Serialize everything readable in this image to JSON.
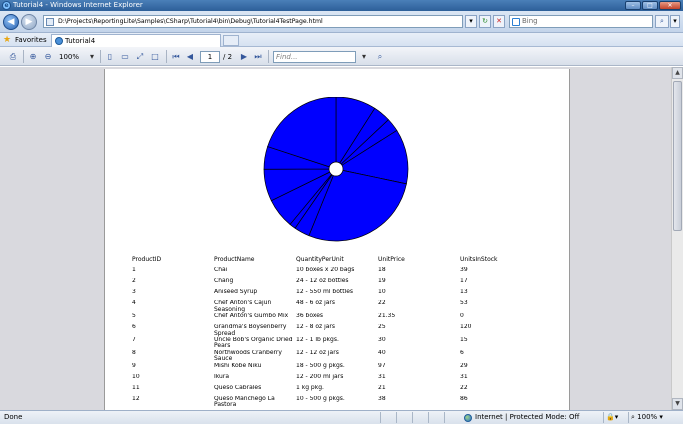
{
  "window": {
    "title": "Tutorial4 - Windows Internet Explorer",
    "controls": [
      "minimize",
      "maximize",
      "close"
    ]
  },
  "navigation": {
    "address": "D:\\Projects\\ReportingLite\\Samples\\CSharp\\Tutorial4\\bin\\Debug\\Tutorial4TestPage.html",
    "search_placeholder": "Bing"
  },
  "favorites": {
    "label": "Favorites",
    "tab_title": "Tutorial4"
  },
  "report_toolbar": {
    "zoom": "100%",
    "current_page": "1",
    "total_pages": "/ 2",
    "find_placeholder": "Find..."
  },
  "chart_data": {
    "type": "pie",
    "title": "",
    "donut_hole": true,
    "fill_color": "#0000ff",
    "edge_color": "#000000",
    "values": [
      39,
      17,
      13,
      53,
      0,
      120,
      15,
      6,
      29,
      31,
      22,
      86
    ]
  },
  "table": {
    "columns": [
      "ProductID",
      "ProductName",
      "QuantityPerUnit",
      "UnitPrice",
      "UnitsInStock"
    ],
    "rows": [
      [
        "1",
        "Chai",
        "10 boxes x 20 bags",
        "18",
        "39"
      ],
      [
        "2",
        "Chang",
        "24 - 12 oz bottles",
        "19",
        "17"
      ],
      [
        "3",
        "Aniseed Syrup",
        "12 - 550 ml bottles",
        "10",
        "13"
      ],
      [
        "4",
        "Chef Anton's Cajun Seasoning",
        "48 - 6 oz jars",
        "22",
        "53"
      ],
      [
        "5",
        "Chef Anton's Gumbo Mix",
        "36 boxes",
        "21.35",
        "0"
      ],
      [
        "6",
        "Grandma's Boysenberry Spread",
        "12 - 8 oz jars",
        "25",
        "120"
      ],
      [
        "7",
        "Uncle Bob's Organic Dried Pears",
        "12 - 1 lb pkgs.",
        "30",
        "15"
      ],
      [
        "8",
        "Northwoods Cranberry Sauce",
        "12 - 12 oz jars",
        "40",
        "6"
      ],
      [
        "9",
        "Mishi Kobe Niku",
        "18 - 500 g pkgs.",
        "97",
        "29"
      ],
      [
        "10",
        "Ikura",
        "12 - 200 ml jars",
        "31",
        "31"
      ],
      [
        "11",
        "Queso Cabrales",
        "1 kg pkg.",
        "21",
        "22"
      ],
      [
        "12",
        "Queso Manchego La Pastora",
        "10 - 500 g pkgs.",
        "38",
        "86"
      ]
    ]
  },
  "status": {
    "left": "Done",
    "zone": "Internet | Protected Mode: Off",
    "zoom": "100%"
  }
}
